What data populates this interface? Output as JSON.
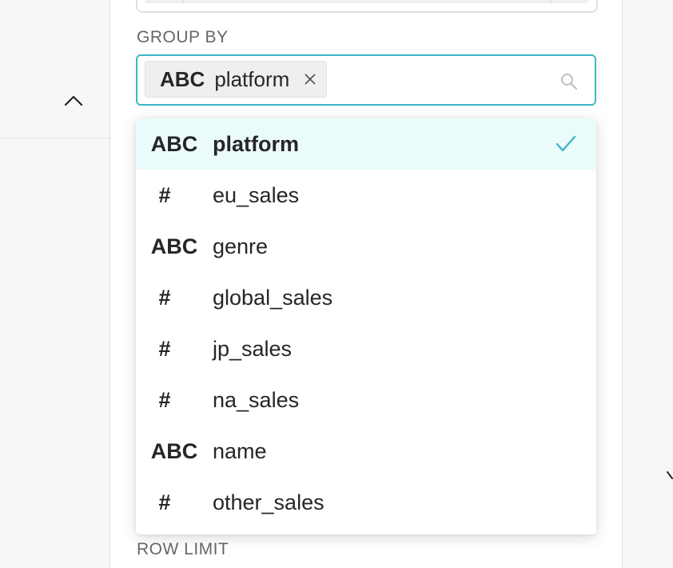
{
  "group_by": {
    "label": "GROUP BY",
    "selected_tag": {
      "type_label": "ABC",
      "value": "platform"
    }
  },
  "dropdown": {
    "options": [
      {
        "type_label": "ABC",
        "label": "platform",
        "selected": true
      },
      {
        "type_label": "#",
        "label": "eu_sales",
        "selected": false
      },
      {
        "type_label": "ABC",
        "label": "genre",
        "selected": false
      },
      {
        "type_label": "#",
        "label": "global_sales",
        "selected": false
      },
      {
        "type_label": "#",
        "label": "jp_sales",
        "selected": false
      },
      {
        "type_label": "#",
        "label": "na_sales",
        "selected": false
      },
      {
        "type_label": "ABC",
        "label": "name",
        "selected": false
      },
      {
        "type_label": "#",
        "label": "other_sales",
        "selected": false
      }
    ]
  },
  "row_limit": {
    "label": "ROW LIMIT"
  },
  "colors": {
    "accent": "#3fb5c7",
    "selected_bg": "#ebfbfc",
    "text": "#262626",
    "label": "#666666"
  },
  "icons": {
    "collapse": "chevron-up-icon",
    "remove_tag": "close-icon",
    "search": "search-icon",
    "selected": "check-icon"
  }
}
